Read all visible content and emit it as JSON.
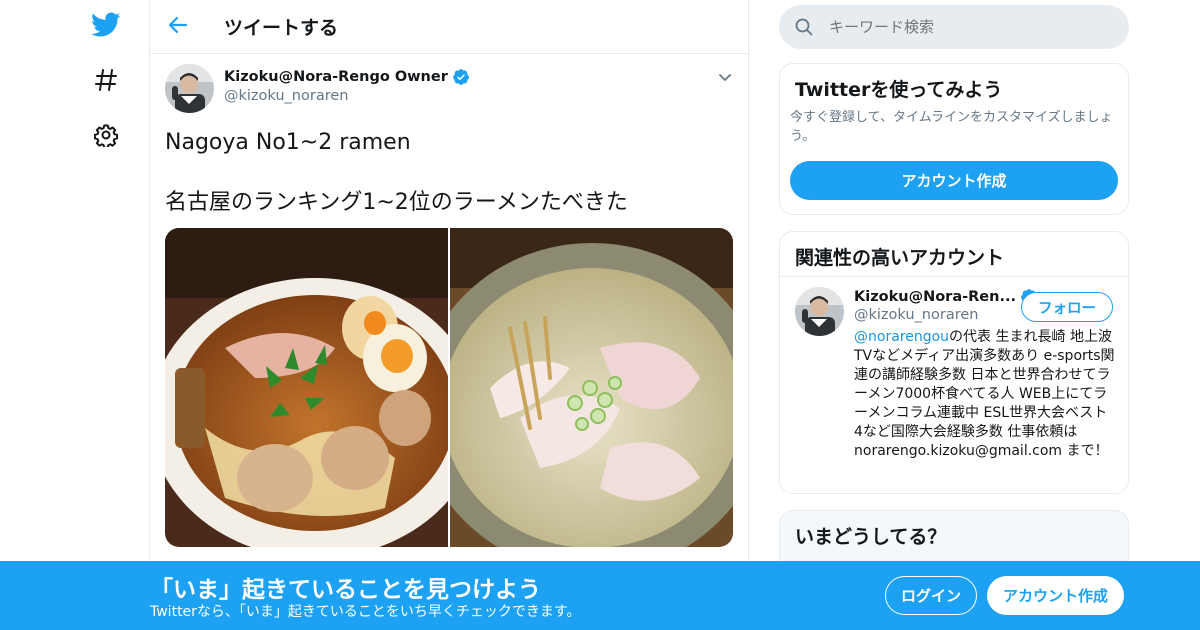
{
  "nav": {
    "icons": [
      "twitter-bird-icon",
      "hashtag-icon",
      "gear-icon"
    ],
    "accent": "#1da1f2"
  },
  "header": {
    "title": "ツイートする"
  },
  "tweet": {
    "author_name": "Kizoku@Nora-Rengo Owner",
    "author_handle": "@kizoku_noraren",
    "verified": true,
    "text_line1": "Nagoya No1~2 ramen",
    "text_line2": "名古屋のランキング1~2位のラーメンたべきた",
    "media_count": 2
  },
  "search": {
    "placeholder": "キーワード検索"
  },
  "signup_card": {
    "title": "Twitterを使ってみよう",
    "subtitle": "今すぐ登録して、タイムラインをカスタマイズしましょう。",
    "button": "アカウント作成"
  },
  "related": {
    "title": "関連性の高いアカウント",
    "user": {
      "name": "Kizoku@Nora-Ren...",
      "handle": "@kizoku_noraren",
      "follow_label": "フォロー",
      "bio_mention": "@norarengou",
      "bio_rest": "の代表 生まれ長崎 地上波TVなどメディア出演多数あり e-sports関連の講師経験多数 日本と世界合わせてラーメン7000杯食べてる人 WEB上にてラーメンコラム連載中 ESL世界大会ベスト4など国際大会経験多数 仕事依頼は norarengo.kizoku@gmail.com まで！"
    }
  },
  "happening": {
    "title": "いまどうしてる？"
  },
  "banner": {
    "title": "「いま」起きていることを見つけよう",
    "subtitle": "Twitterなら、「いま」起きていることをいち早くチェックできます。",
    "login": "ログイン",
    "signup": "アカウント作成",
    "background": "#1da1f2"
  }
}
